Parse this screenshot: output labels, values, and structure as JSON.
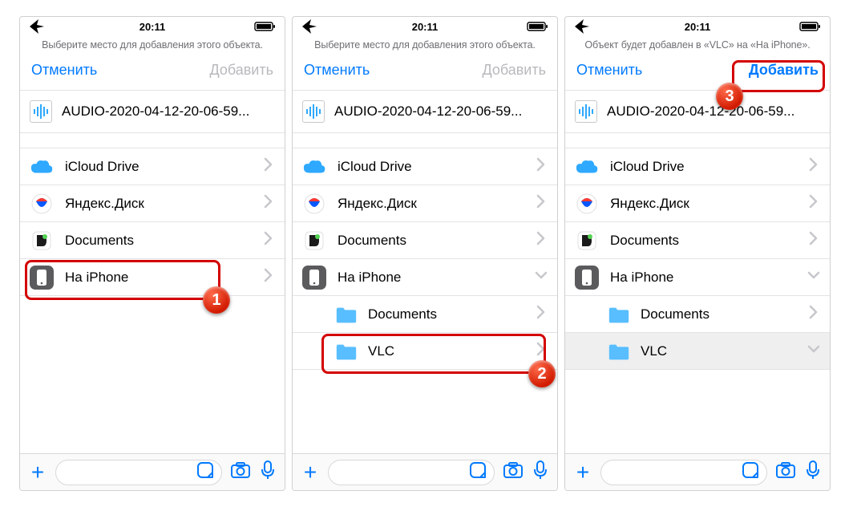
{
  "status": {
    "time": "20:11"
  },
  "screens": [
    {
      "prompt": "Выберите место для добавления этого объекта.",
      "cancel": "Отменить",
      "add": "Добавить",
      "add_enabled": false,
      "file": "AUDIO-2020-04-12-20-06-59...",
      "rows": [
        {
          "kind": "icloud",
          "label": "iCloud Drive",
          "disclosure": "chevron"
        },
        {
          "kind": "yandex",
          "label": "Яндекс.Диск",
          "disclosure": "chevron"
        },
        {
          "kind": "docsapp",
          "label": "Documents",
          "disclosure": "chevron"
        },
        {
          "kind": "iphone",
          "label": "На iPhone",
          "disclosure": "chevron",
          "highlight": true
        }
      ],
      "callout": {
        "row_index": 3,
        "badge": "1"
      }
    },
    {
      "prompt": "Выберите место для добавления этого объекта.",
      "cancel": "Отменить",
      "add": "Добавить",
      "add_enabled": false,
      "file": "AUDIO-2020-04-12-20-06-59...",
      "rows": [
        {
          "kind": "icloud",
          "label": "iCloud Drive",
          "disclosure": "chevron"
        },
        {
          "kind": "yandex",
          "label": "Яндекс.Диск",
          "disclosure": "chevron"
        },
        {
          "kind": "docsapp",
          "label": "Documents",
          "disclosure": "chevron"
        },
        {
          "kind": "iphone",
          "label": "На iPhone",
          "disclosure": "down"
        },
        {
          "kind": "folder",
          "label": "Documents",
          "disclosure": "chevron",
          "sub": true
        },
        {
          "kind": "folder",
          "label": "VLC",
          "disclosure": "chevron",
          "sub": true,
          "highlight": true
        }
      ],
      "callout": {
        "row_index": 5,
        "badge": "2"
      }
    },
    {
      "prompt": "Объект будет добавлен в «VLC» на «На iPhone».",
      "cancel": "Отменить",
      "add": "Добавить",
      "add_enabled": true,
      "file": "AUDIO-2020-04-12-20-06-59...",
      "rows": [
        {
          "kind": "icloud",
          "label": "iCloud Drive",
          "disclosure": "chevron"
        },
        {
          "kind": "yandex",
          "label": "Яндекс.Диск",
          "disclosure": "chevron"
        },
        {
          "kind": "docsapp",
          "label": "Documents",
          "disclosure": "chevron"
        },
        {
          "kind": "iphone",
          "label": "На iPhone",
          "disclosure": "down"
        },
        {
          "kind": "folder",
          "label": "Documents",
          "disclosure": "chevron",
          "sub": true
        },
        {
          "kind": "folder",
          "label": "VLC",
          "disclosure": "down",
          "sub": true,
          "selected": true
        }
      ],
      "callout_add": {
        "badge": "3"
      }
    }
  ]
}
